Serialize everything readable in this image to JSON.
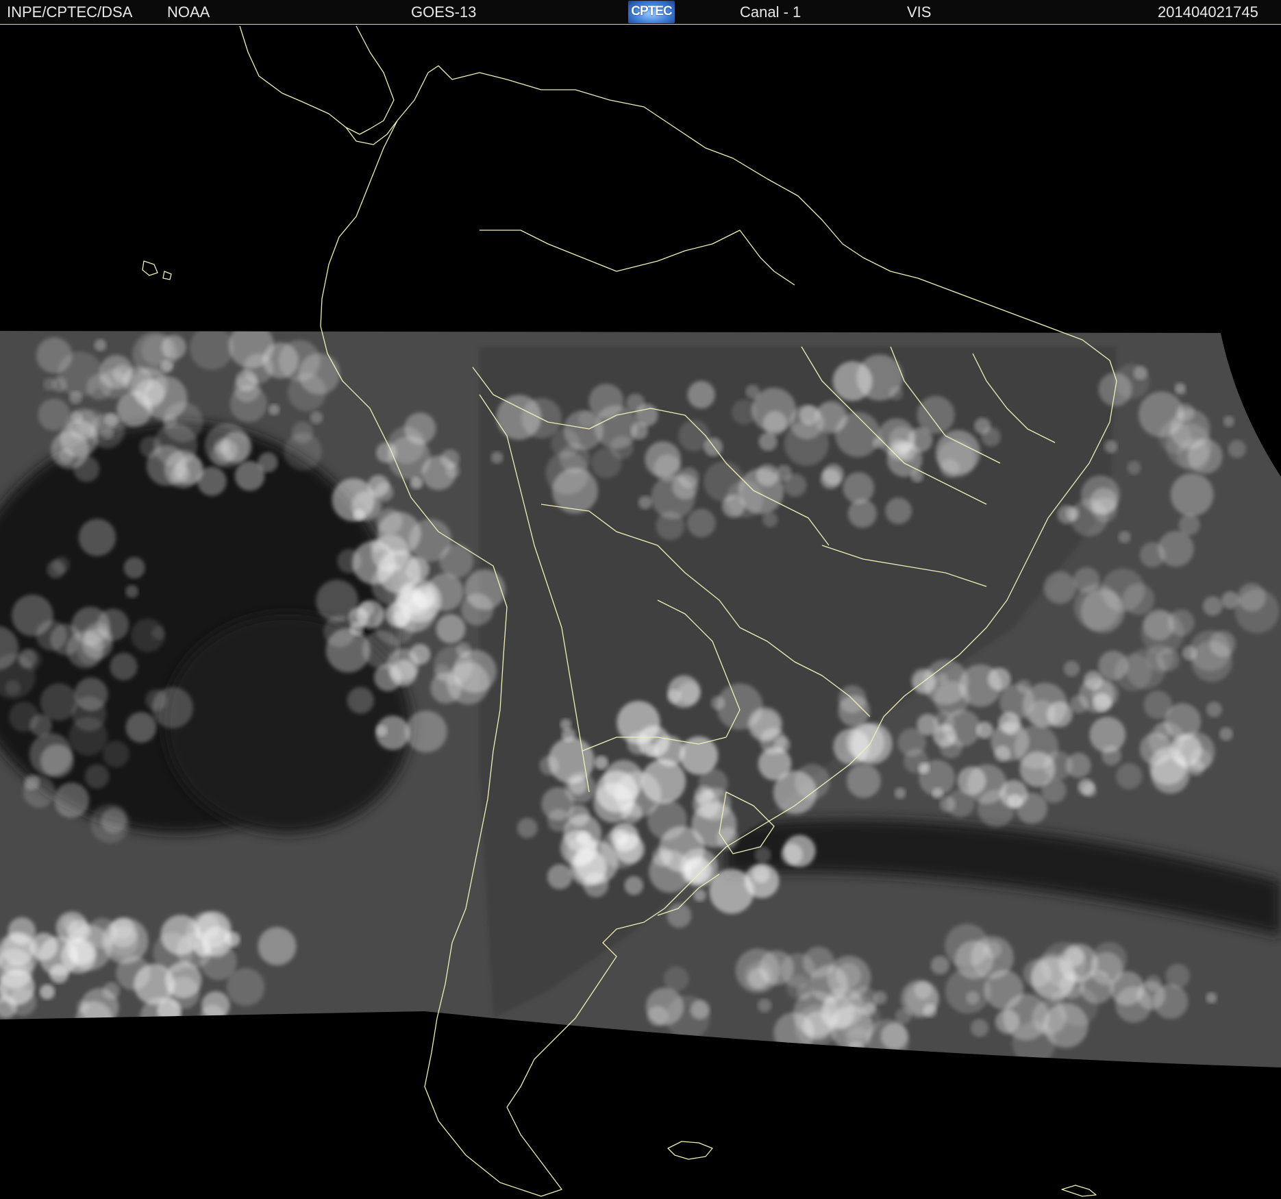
{
  "header": {
    "agency": "INPE/CPTEC/DSA",
    "provider": "NOAA",
    "satellite": "GOES-13",
    "logo_text": "CPTEC",
    "channel": "Canal - 1",
    "band": "VIS",
    "timestamp": "201404021745"
  },
  "map": {
    "background_color": "#000000",
    "boundary_color": "#f0f0b8",
    "cloud_color": "#ffffff",
    "imagery_base_color": "#4a4a4a"
  }
}
